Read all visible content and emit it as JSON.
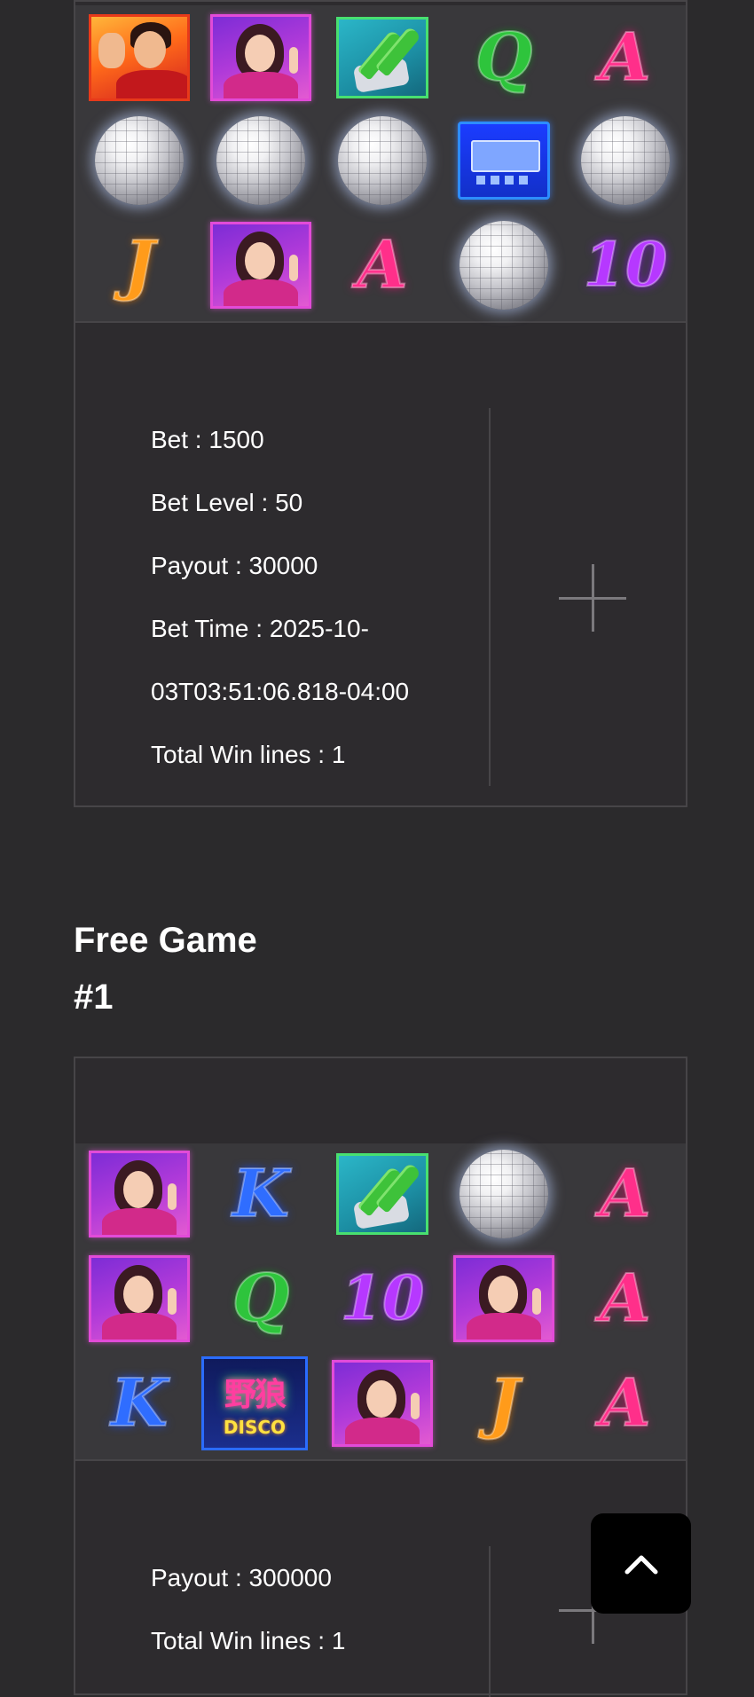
{
  "rounds": [
    {
      "reels": [
        [
          "man-symbol",
          "lady-symbol",
          "champagne-symbol",
          "Q",
          "A"
        ],
        [
          "disco-ball",
          "disco-ball",
          "disco-ball",
          "pager-symbol",
          "disco-ball"
        ],
        [
          "J",
          "lady-symbol",
          "A",
          "disco-ball",
          "10"
        ]
      ],
      "info": {
        "bet": "Bet : 1500",
        "bet_level": "Bet Level : 50",
        "payout": "Payout : 30000",
        "bet_time_line1": "Bet Time : 2025-10-",
        "bet_time_line2": "03T03:51:06.818-04:00",
        "total_win_lines": "Total Win lines : 1"
      },
      "expand_icon": "plus-icon"
    },
    {
      "title_line1": "Free Game",
      "title_line2": "#1",
      "reels": [
        [
          "lady-symbol",
          "K",
          "champagne-symbol",
          "disco-ball",
          "A"
        ],
        [
          "lady-symbol",
          "Q",
          "10",
          "lady-symbol",
          "A"
        ],
        [
          "K",
          "wild-disco-logo",
          "lady-symbol",
          "J",
          "A"
        ]
      ],
      "logo": {
        "cn": "野狼",
        "en": "DISCO"
      },
      "info": {
        "payout": "Payout : 300000",
        "total_win_lines": "Total Win lines : 1"
      },
      "expand_icon": "plus-icon"
    }
  ],
  "scroll_top_icon": "chevron-up-icon"
}
